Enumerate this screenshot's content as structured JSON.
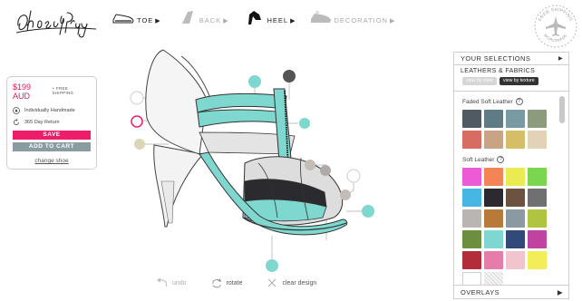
{
  "brand": {
    "logo_text": "Shoes of Prey"
  },
  "steps": [
    {
      "label": "TOE",
      "icon": "toe-shape-icon",
      "active": true
    },
    {
      "label": "BACK",
      "icon": "back-shape-icon",
      "active": false
    },
    {
      "label": "HEEL",
      "icon": "heel-shape-icon",
      "active": true
    },
    {
      "label": "DECORATION",
      "icon": "decoration-icon",
      "active": false
    }
  ],
  "badge": {
    "top": "FREE SHIPPING",
    "bottom": "WORLDWIDE"
  },
  "price_panel": {
    "price": "$199 AUD",
    "shipping": "+ FREE SHIPPING",
    "feature_1": "Individually Handmade",
    "feature_2": "365 Day Return",
    "save_label": "SAVE",
    "cart_label": "ADD TO CART",
    "change_label": "change shoe"
  },
  "actions": {
    "undo": "undo",
    "rotate": "rotate",
    "clear": "clear design"
  },
  "right_panel": {
    "your_selections": "YOUR SELECTIONS",
    "leathers_title": "LEATHERS & FABRICS",
    "view_color": "view by color",
    "view_texture": "view by texture",
    "faded_title": "Faded Soft Leather",
    "soft_title": "Soft Leather",
    "overlays": "OVERLAYS",
    "help_glyph": "?"
  },
  "colors": {
    "accent_pink": "#ee1d69",
    "shoe_teal": "#7ed8cf",
    "faded": [
      "#4f5a63",
      "#5f7b85",
      "#7a9aa3",
      "#8c9b7e",
      "#d66c62",
      "#c9a385",
      "#d6bd68",
      "#e3d3b6"
    ],
    "soft": [
      "#ec5ad6",
      "#f28455",
      "#eaea53",
      "#7ad54f",
      "#46b6e4",
      "#2b2b2f",
      "#6b5241",
      "#707070",
      "#b9b5b0",
      "#b77a38",
      "#8b9aa2",
      "#b0c442",
      "#6c8f3f",
      "#7fd7d1",
      "#314a7a",
      "#c0449f",
      "#b32c3a",
      "#e67ca9",
      "#f2c4cd",
      "#f1ee5a",
      "#ffffff",
      "hatch"
    ]
  }
}
